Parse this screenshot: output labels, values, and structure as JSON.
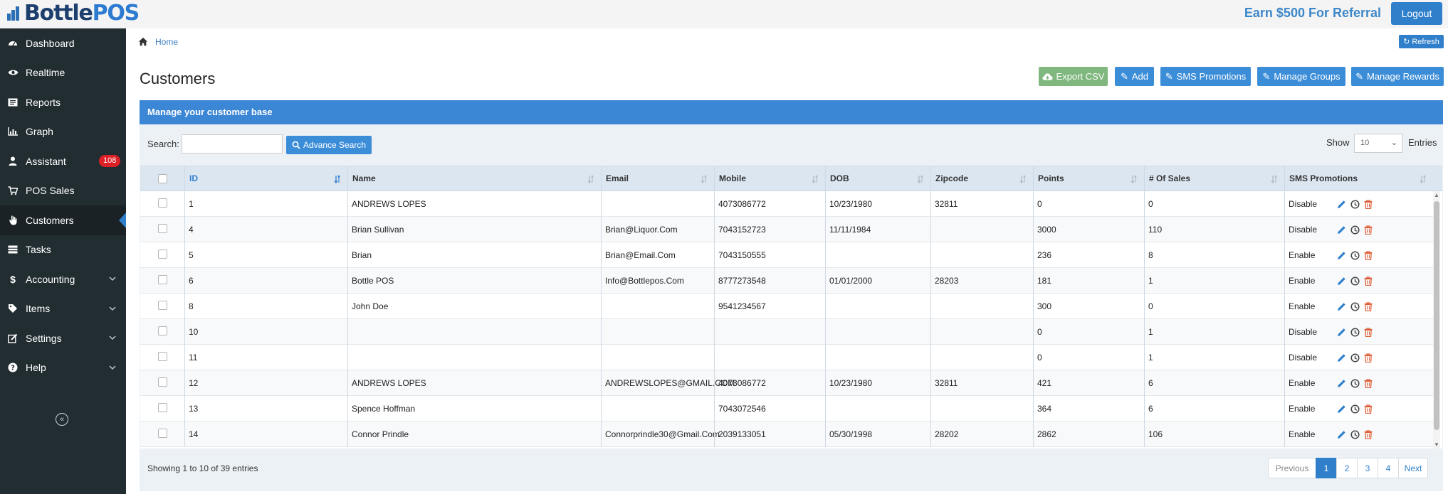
{
  "brand": {
    "part1": "Bottle",
    "part2": "POS"
  },
  "header": {
    "referral": "Earn $500 For Referral",
    "logout": "Logout"
  },
  "sidebar": {
    "items": [
      {
        "label": "Dashboard",
        "icon": "dashboard-icon"
      },
      {
        "label": "Realtime",
        "icon": "eye-icon"
      },
      {
        "label": "Reports",
        "icon": "report-icon"
      },
      {
        "label": "Graph",
        "icon": "bar-chart-icon"
      },
      {
        "label": "Assistant",
        "icon": "user-icon",
        "badge": "108"
      },
      {
        "label": "POS Sales",
        "icon": "cart-icon"
      },
      {
        "label": "Customers",
        "icon": "hand-icon",
        "active": true
      },
      {
        "label": "Tasks",
        "icon": "list-icon"
      },
      {
        "label": "Accounting",
        "icon": "dollar-icon",
        "expandable": true
      },
      {
        "label": "Items",
        "icon": "tag-icon",
        "expandable": true
      },
      {
        "label": "Settings",
        "icon": "edit-icon",
        "expandable": true
      },
      {
        "label": "Help",
        "icon": "question-icon",
        "expandable": true
      }
    ]
  },
  "breadcrumb": {
    "home": "Home"
  },
  "toolbar": {
    "refresh": "Refresh",
    "export_csv": "Export CSV",
    "add": "Add",
    "sms_promotions": "SMS Promotions",
    "manage_groups": "Manage Groups",
    "manage_rewards": "Manage Rewards"
  },
  "page": {
    "title": "Customers",
    "panel_title": "Manage your customer base"
  },
  "search": {
    "label": "Search:",
    "value": "",
    "advance": "Advance Search"
  },
  "pagesize": {
    "show": "Show",
    "value": "10",
    "entries": "Entries"
  },
  "table": {
    "columns": [
      "ID",
      "Name",
      "Email",
      "Mobile",
      "DOB",
      "Zipcode",
      "Points",
      "# Of Sales",
      "SMS Promotions"
    ],
    "rows": [
      [
        "1",
        "ANDREWS LOPES",
        "",
        "4073086772",
        "10/23/1980",
        "32811",
        "0",
        "0",
        "Disable"
      ],
      [
        "4",
        "Brian Sullivan",
        "Brian@Liquor.Com",
        "7043152723",
        "11/11/1984",
        "",
        "3000",
        "110",
        "Disable"
      ],
      [
        "5",
        "Brian",
        "Brian@Email.Com",
        "7043150555",
        "",
        "",
        "236",
        "8",
        "Enable"
      ],
      [
        "6",
        "Bottle POS",
        "Info@Bottlepos.Com",
        "8777273548",
        "01/01/2000",
        "28203",
        "181",
        "1",
        "Enable"
      ],
      [
        "8",
        "John Doe",
        "",
        "9541234567",
        "",
        "",
        "300",
        "0",
        "Enable"
      ],
      [
        "10",
        "",
        "",
        "",
        "",
        "",
        "0",
        "1",
        "Disable"
      ],
      [
        "11",
        "",
        "",
        "",
        "",
        "",
        "0",
        "1",
        "Disable"
      ],
      [
        "12",
        "ANDREWS LOPES",
        "ANDREWSLOPES@GMAIL.COM",
        "4073086772",
        "10/23/1980",
        "32811",
        "421",
        "6",
        "Enable"
      ],
      [
        "13",
        "Spence Hoffman",
        "",
        "7043072546",
        "",
        "",
        "364",
        "6",
        "Enable"
      ],
      [
        "14",
        "Connor Prindle",
        "Connorprindle30@Gmail.Com",
        "2039133051",
        "05/30/1998",
        "28202",
        "2862",
        "106",
        "Enable"
      ]
    ]
  },
  "footer": {
    "showing": "Showing 1 to 10 of 39 entries"
  },
  "pagination": {
    "previous": "Previous",
    "pages": [
      "1",
      "2",
      "3",
      "4"
    ],
    "next": "Next",
    "current": "1"
  },
  "colors": {
    "primary": "#2f7fcb",
    "panel_head": "#3c86d6",
    "sidebar": "#222d32",
    "export": "#7fb77e",
    "delete": "#e0603a"
  }
}
